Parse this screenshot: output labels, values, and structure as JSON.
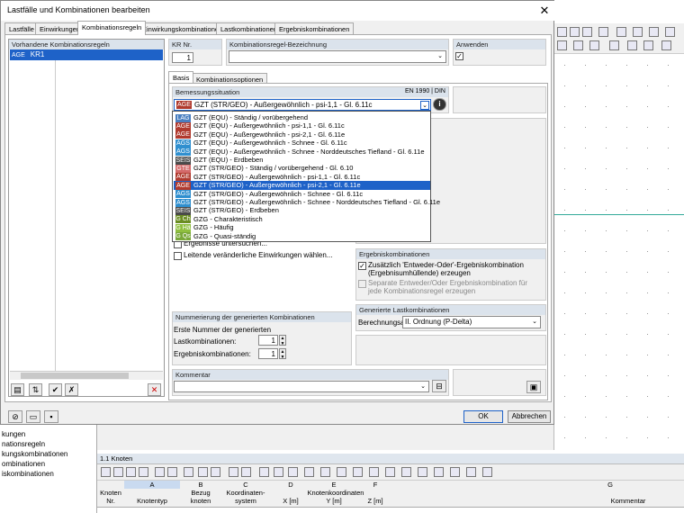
{
  "dialog": {
    "title": "Lastfälle und Kombinationen bearbeiten",
    "close_glyph": "✕",
    "tabs": [
      "Lastfälle",
      "Einwirkungen",
      "Kombinationsregeln",
      "Einwirkungskombinationen",
      "Lastkombinationen",
      "Ergebniskombinationen"
    ]
  },
  "rules_panel": {
    "header": "Vorhandene Kombinationsregeln",
    "items": [
      {
        "badge": "AGE",
        "label": "KR1"
      }
    ]
  },
  "kr_nr": {
    "label": "KR Nr.",
    "value": "1"
  },
  "kr_name": {
    "label": "Kombinationsregel-Bezeichnung",
    "value": ""
  },
  "apply": {
    "label": "Anwenden",
    "checked": "✓"
  },
  "subtabs": [
    "Basis",
    "Kombinationsoptionen"
  ],
  "design_situation": {
    "label": "Bemessungssituation",
    "norm": "EN 1990 | DIN",
    "selected_badge": "AGE",
    "selected": "GZT (STR/GEO) - Außergewöhnlich - psi-1,1 - Gl. 6.11c",
    "options": [
      {
        "badge": "LAG",
        "text": "GZT (EQU) - Ständig / vorübergehend"
      },
      {
        "badge": "AGE",
        "text": "GZT (EQU) - Außergewöhnlich - psi-1,1 - Gl. 6.11c"
      },
      {
        "badge": "AGE",
        "text": "GZT (EQU) - Außergewöhnlich - psi-2,1 - Gl. 6.11e"
      },
      {
        "badge": "AGS",
        "text": "GZT (EQU) - Außergewöhnlich - Schnee - Gl. 6.11c"
      },
      {
        "badge": "AGS",
        "text": "GZT (EQU) - Außergewöhnlich - Schnee - Norddeutsches Tiefland - Gl. 6.11e"
      },
      {
        "badge": "SEIS",
        "text": "GZT (EQU) - Erdbeben"
      },
      {
        "badge": "GTE",
        "text": "GZT (STR/GEO) - Ständig / vorübergehend - Gl. 6.10"
      },
      {
        "badge": "AGE",
        "text": "GZT (STR/GEO) - Außergewöhnlich - psi-1,1 - Gl. 6.11c"
      },
      {
        "badge": "AGE",
        "text": "GZT (STR/GEO) - Außergewöhnlich - psi-2,1 - Gl. 6.11e"
      },
      {
        "badge": "AGS",
        "text": "GZT (STR/GEO) - Außergewöhnlich - Schnee - Gl. 6.11c"
      },
      {
        "badge": "AGS",
        "text": "GZT (STR/GEO) - Außergewöhnlich - Schnee - Norddeutsches Tiefland - Gl. 6.11e"
      },
      {
        "badge": "SEIS",
        "text": "GZT (STR/GEO) - Erdbeben"
      },
      {
        "badge": "G Ch",
        "text": "GZG - Charakteristisch"
      },
      {
        "badge": "G Hä",
        "text": "GZG - Häufig"
      },
      {
        "badge": "G Qs",
        "text": "GZG - Quasi-ständig"
      }
    ],
    "highlighted_index": 8
  },
  "checks": {
    "results_investigate": "Ergebnisse untersuchen...",
    "leading_variable": "Leitende veränderliche Einwirkungen wählen..."
  },
  "result_combinations": {
    "header": "Ergebniskombinationen",
    "opt1": "Zusätzlich 'Entweder-Oder'-Ergebniskombination (Ergebnisumhüllende) erzeugen",
    "opt1_checked": "✓",
    "opt2": "Separate Entweder/Oder Ergebniskombination für jede Kombinationsregel erzeugen"
  },
  "generated": {
    "header": "Generierte Lastkombinationen",
    "calc_label": "Berechnungsart:",
    "calc_value": "II. Ordnung (P-Delta)"
  },
  "numbering": {
    "header": "Nummerierung der generierten Kombinationen",
    "first_label": "Erste Nummer der generierten",
    "lk_label": "Lastkombinationen:",
    "lk_value": "1",
    "ek_label": "Ergebniskombinationen:",
    "ek_value": "1"
  },
  "comment": {
    "label": "Kommentar",
    "value": ""
  },
  "buttons": {
    "ok": "OK",
    "cancel": "Abbrechen"
  },
  "nav_tree": [
    "kungen",
    "nationsregeln",
    "kungskombinationen",
    "ombinationen",
    "iskombinationen"
  ],
  "table": {
    "title": "1.1 Knoten",
    "col_letters": [
      "A",
      "B",
      "C",
      "D",
      "E",
      "F",
      "G"
    ],
    "headers": [
      "Knoten\nNr.",
      "Knotentyp",
      "Bezug\nknoten",
      "Koordinaten-\nsystem",
      "X [m]",
      "Y [m]",
      "Z [m]",
      "Kommentar"
    ],
    "coords_group": "Knotenkoordinaten"
  },
  "colors": {
    "accent": "#1e62c8",
    "header_band": "#dbe3ec"
  }
}
